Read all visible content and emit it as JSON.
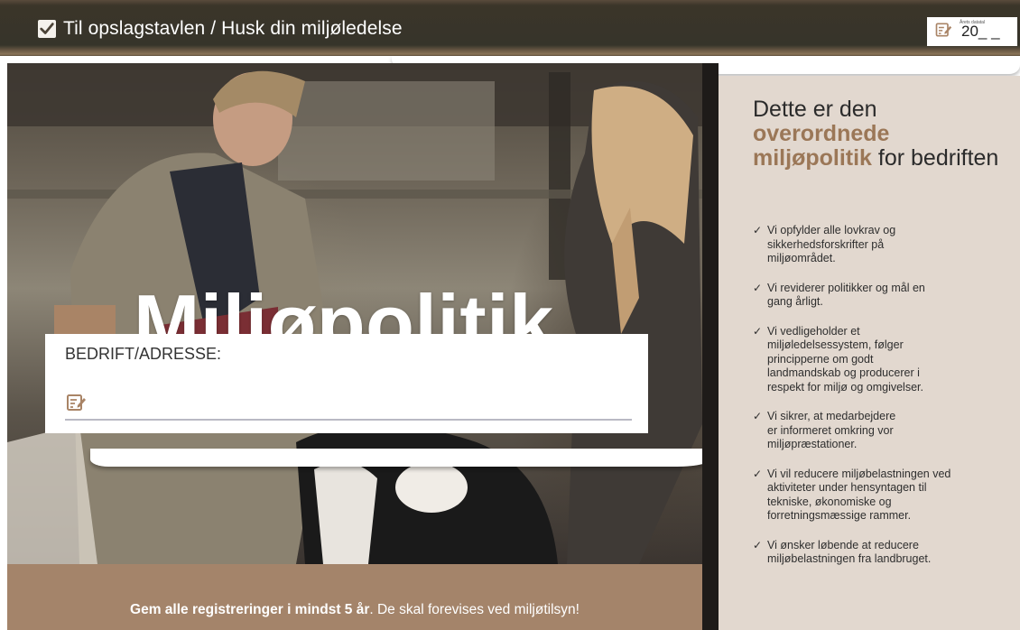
{
  "header": {
    "title": "Til opslagstavlen / Husk din miljøledelse",
    "year_caption": "Årets datatal",
    "year_value": "20_ _"
  },
  "main": {
    "title": "Miljøpolitik",
    "form_label": "BEDRIFT/ADRESSE:",
    "form_value": ""
  },
  "panel": {
    "heading_pre": "Dette er den",
    "heading_accent": "overordnede miljøpolitik",
    "heading_post": "for bedriften",
    "items": [
      {
        "text": "Vi opfylder alle lovkrav og\nsikkerhedsforskrifter på\nmiljøområdet."
      },
      {
        "text": "Vi reviderer politikker og mål en\ngang årligt."
      },
      {
        "text": "Vi vedligeholder et\nmiljøledelsessystem, følger\nprincipperne om godt\nlandmandskab og producerer i\nrespekt for miljø og omgivelser."
      },
      {
        "text": "Vi sikrer, at medarbejdere\ner informeret omkring vor\nmiljøpræstationer."
      },
      {
        "text": "Vi vil reducere miljøbelastningen ved\naktiviteter under hensyntagen til\ntekniske, økonomiske og\nforretningsmæssige rammer."
      },
      {
        "text": "Vi ønsker løbende at reducere\nmiljøbelastningen fra landbruget."
      }
    ],
    "check_symbol": "✓"
  },
  "footer": {
    "bold": "Gem alle registreringer i mindst 5 år",
    "rest": ". De skal forevises ved miljøtilsyn!"
  },
  "colors": {
    "accent_brown": "#9b7757",
    "panel_bg": "#e2d8cf",
    "footer_bg": "#a4846a",
    "header_bg": "#36342a"
  },
  "icons": [
    "checkbox-checked-icon",
    "edit-note-icon"
  ]
}
